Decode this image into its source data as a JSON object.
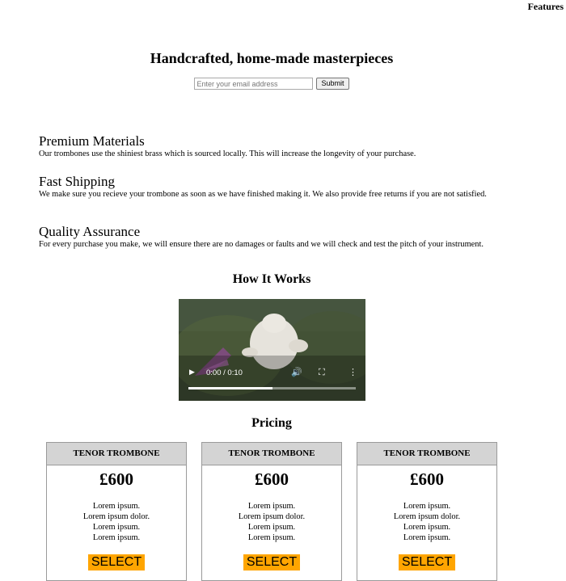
{
  "nav": {
    "features": "Features"
  },
  "hero": {
    "title": "Handcrafted, home-made masterpieces",
    "email_placeholder": "Enter your email address",
    "submit_label": "Submit"
  },
  "features": [
    {
      "title": "Premium Materials",
      "text": "Our trombones use the shiniest brass which is sourced locally. This will increase the longevity of your purchase."
    },
    {
      "title": "Fast Shipping",
      "text": "We make sure you recieve your trombone as soon as we have finished making it. We also provide free returns if you are not satisfied."
    },
    {
      "title": "Quality Assurance",
      "text": "For every purchase you make, we will ensure there are no damages or faults and we will check and test the pitch of your instrument."
    }
  ],
  "how_it_works": {
    "title": "How It Works",
    "video": {
      "time": "0:00 / 0:10",
      "buffered_fraction": 0.5
    }
  },
  "pricing": {
    "title": "Pricing",
    "plans": [
      {
        "name": "TENOR TROMBONE",
        "price": "£600",
        "features": [
          "Lorem ipsum.",
          "Lorem ipsum dolor.",
          "Lorem ipsum.",
          "Lorem ipsum."
        ],
        "button": "SELECT"
      },
      {
        "name": "TENOR TROMBONE",
        "price": "£600",
        "features": [
          "Lorem ipsum.",
          "Lorem ipsum dolor.",
          "Lorem ipsum.",
          "Lorem ipsum."
        ],
        "button": "SELECT"
      },
      {
        "name": "TENOR TROMBONE",
        "price": "£600",
        "features": [
          "Lorem ipsum.",
          "Lorem ipsum dolor.",
          "Lorem ipsum.",
          "Lorem ipsum."
        ],
        "button": "SELECT"
      }
    ]
  },
  "colors": {
    "select_button": "#ffa500",
    "plan_header": "#d4d4d4"
  }
}
